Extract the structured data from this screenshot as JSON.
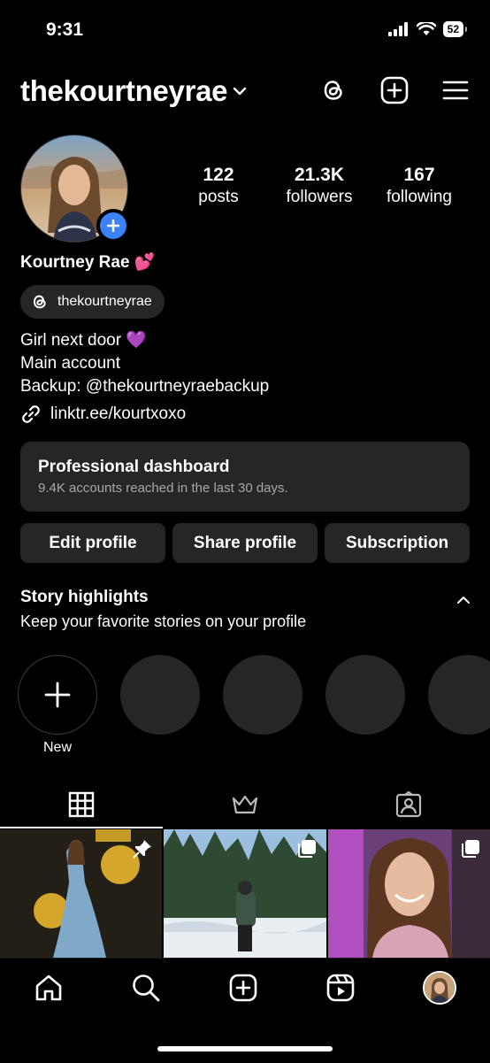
{
  "status_bar": {
    "time": "9:31",
    "battery": "52"
  },
  "header": {
    "username": "thekourtneyrae"
  },
  "profile": {
    "stats": [
      {
        "value": "122",
        "label": "posts"
      },
      {
        "value": "21.3K",
        "label": "followers"
      },
      {
        "value": "167",
        "label": "following"
      }
    ],
    "display_name": "Kourtney Rae 💕",
    "threads_handle": "thekourtneyrae",
    "bio": [
      "Girl next door 💜",
      "Main account",
      "Backup: @thekourtneyraebackup"
    ],
    "link": "linktr.ee/kourtxoxo"
  },
  "dashboard": {
    "title": "Professional dashboard",
    "subtitle": "9.4K accounts reached in the last 30 days."
  },
  "buttons": {
    "edit": "Edit profile",
    "share": "Share profile",
    "subscription": "Subscription"
  },
  "highlights": {
    "title": "Story highlights",
    "subtitle": "Keep your favorite stories on your profile",
    "new_label": "New"
  },
  "colors": {
    "accent": "#3b82f6",
    "surface": "#262626",
    "background": "#000000"
  }
}
